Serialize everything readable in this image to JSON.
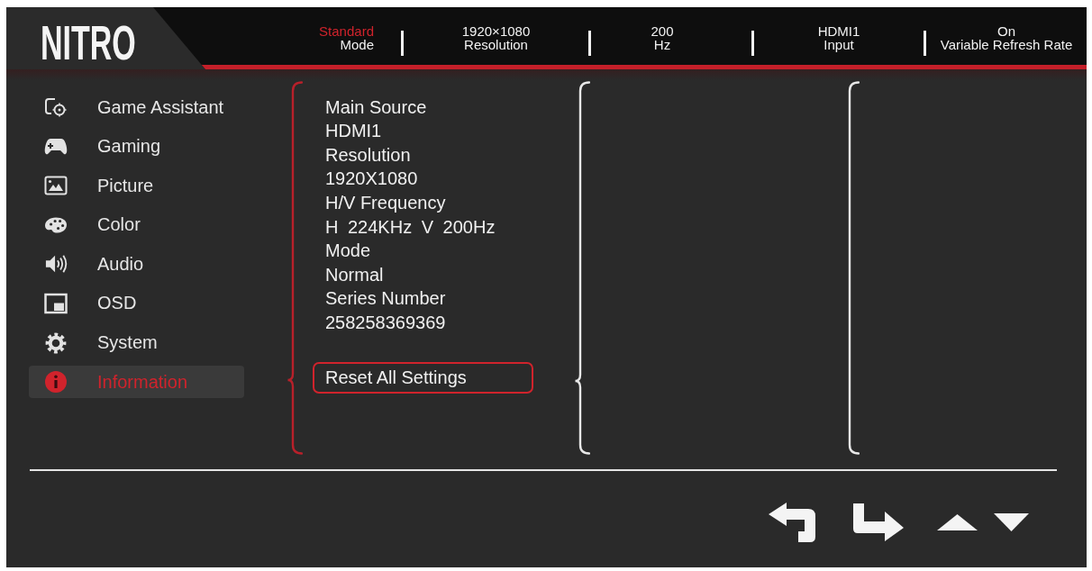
{
  "logo": {
    "text": "NITRO"
  },
  "status_bar": [
    {
      "value": "Standard",
      "label": "Mode",
      "highlighted": true
    },
    {
      "value": "1920×1080",
      "label": "Resolution",
      "highlighted": false
    },
    {
      "value": "200",
      "label": "Hz",
      "highlighted": false
    },
    {
      "value": "HDMI1",
      "label": "Input",
      "highlighted": false
    },
    {
      "value": "On",
      "label": "Variable Refresh Rate",
      "highlighted": false
    }
  ],
  "menu": [
    {
      "label": "Game Assistant",
      "selected": false
    },
    {
      "label": "Gaming",
      "selected": false
    },
    {
      "label": "Picture",
      "selected": false
    },
    {
      "label": "Color",
      "selected": false
    },
    {
      "label": "Audio",
      "selected": false
    },
    {
      "label": "OSD",
      "selected": false
    },
    {
      "label": "System",
      "selected": false
    },
    {
      "label": "Information",
      "selected": true
    }
  ],
  "information": {
    "fields": [
      {
        "label": "Main Source",
        "value": "HDMI1"
      },
      {
        "label": "Resolution",
        "value": "1920X1080"
      },
      {
        "label": "H/V Frequency",
        "value": "H 224KHz V 200Hz"
      },
      {
        "label": "Mode",
        "value": "Normal"
      },
      {
        "label": "Series Number",
        "value": "258258369369"
      }
    ],
    "reset_button": {
      "label": "Reset All Settings",
      "selected": true
    }
  }
}
